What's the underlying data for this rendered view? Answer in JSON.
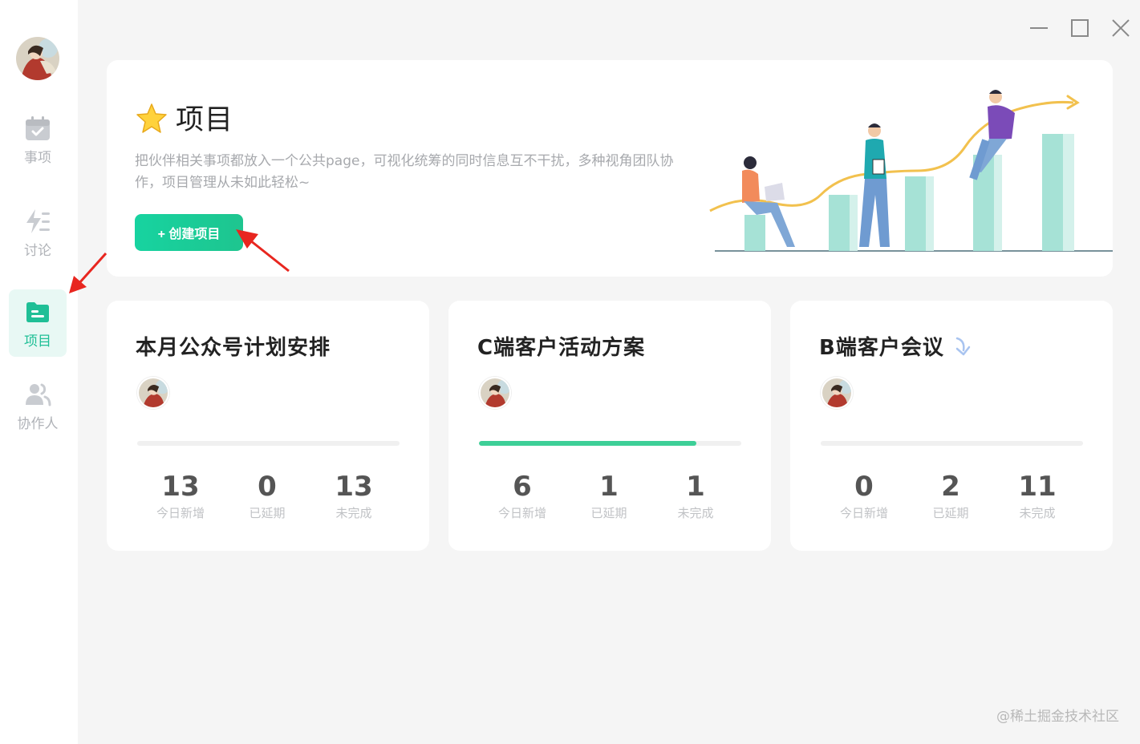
{
  "window": {
    "controls": [
      "minimize",
      "maximize",
      "close"
    ]
  },
  "sidebar": {
    "items": [
      {
        "label": "事项",
        "icon": "calendar-check-icon",
        "active": false
      },
      {
        "label": "讨论",
        "icon": "bolt-list-icon",
        "active": false
      },
      {
        "label": "项目",
        "icon": "folder-icon",
        "active": true
      },
      {
        "label": "协作人",
        "icon": "users-icon",
        "active": false
      }
    ]
  },
  "banner": {
    "title": "项目",
    "title_icon": "star-icon",
    "description": "把伙伴相关事项都放入一个公共page，可视化统筹的同时信息互不干扰，多种视角团队协作，项目管理从未如此轻松~",
    "create_button": "+ 创建项目"
  },
  "projects": [
    {
      "title": "本月公众号计划安排",
      "progress": 0,
      "stats": [
        {
          "value": "13",
          "label": "今日新增"
        },
        {
          "value": "0",
          "label": "已延期"
        },
        {
          "value": "13",
          "label": "未完成"
        }
      ]
    },
    {
      "title": "C端客户活动方案",
      "progress": 0.83,
      "stats": [
        {
          "value": "6",
          "label": "今日新增"
        },
        {
          "value": "1",
          "label": "已延期"
        },
        {
          "value": "1",
          "label": "未完成"
        }
      ]
    },
    {
      "title": "B端客户会议",
      "progress": 0,
      "badge_icon": "loading-arrow-icon",
      "stats": [
        {
          "value": "0",
          "label": "今日新增"
        },
        {
          "value": "2",
          "label": "已延期"
        },
        {
          "value": "11",
          "label": "未完成"
        }
      ]
    }
  ],
  "watermark": "@稀土掘金技术社区",
  "colors": {
    "accent": "#1ec58f",
    "active_bg": "#e8f8f4",
    "annotation_arrow": "#e8261f"
  }
}
